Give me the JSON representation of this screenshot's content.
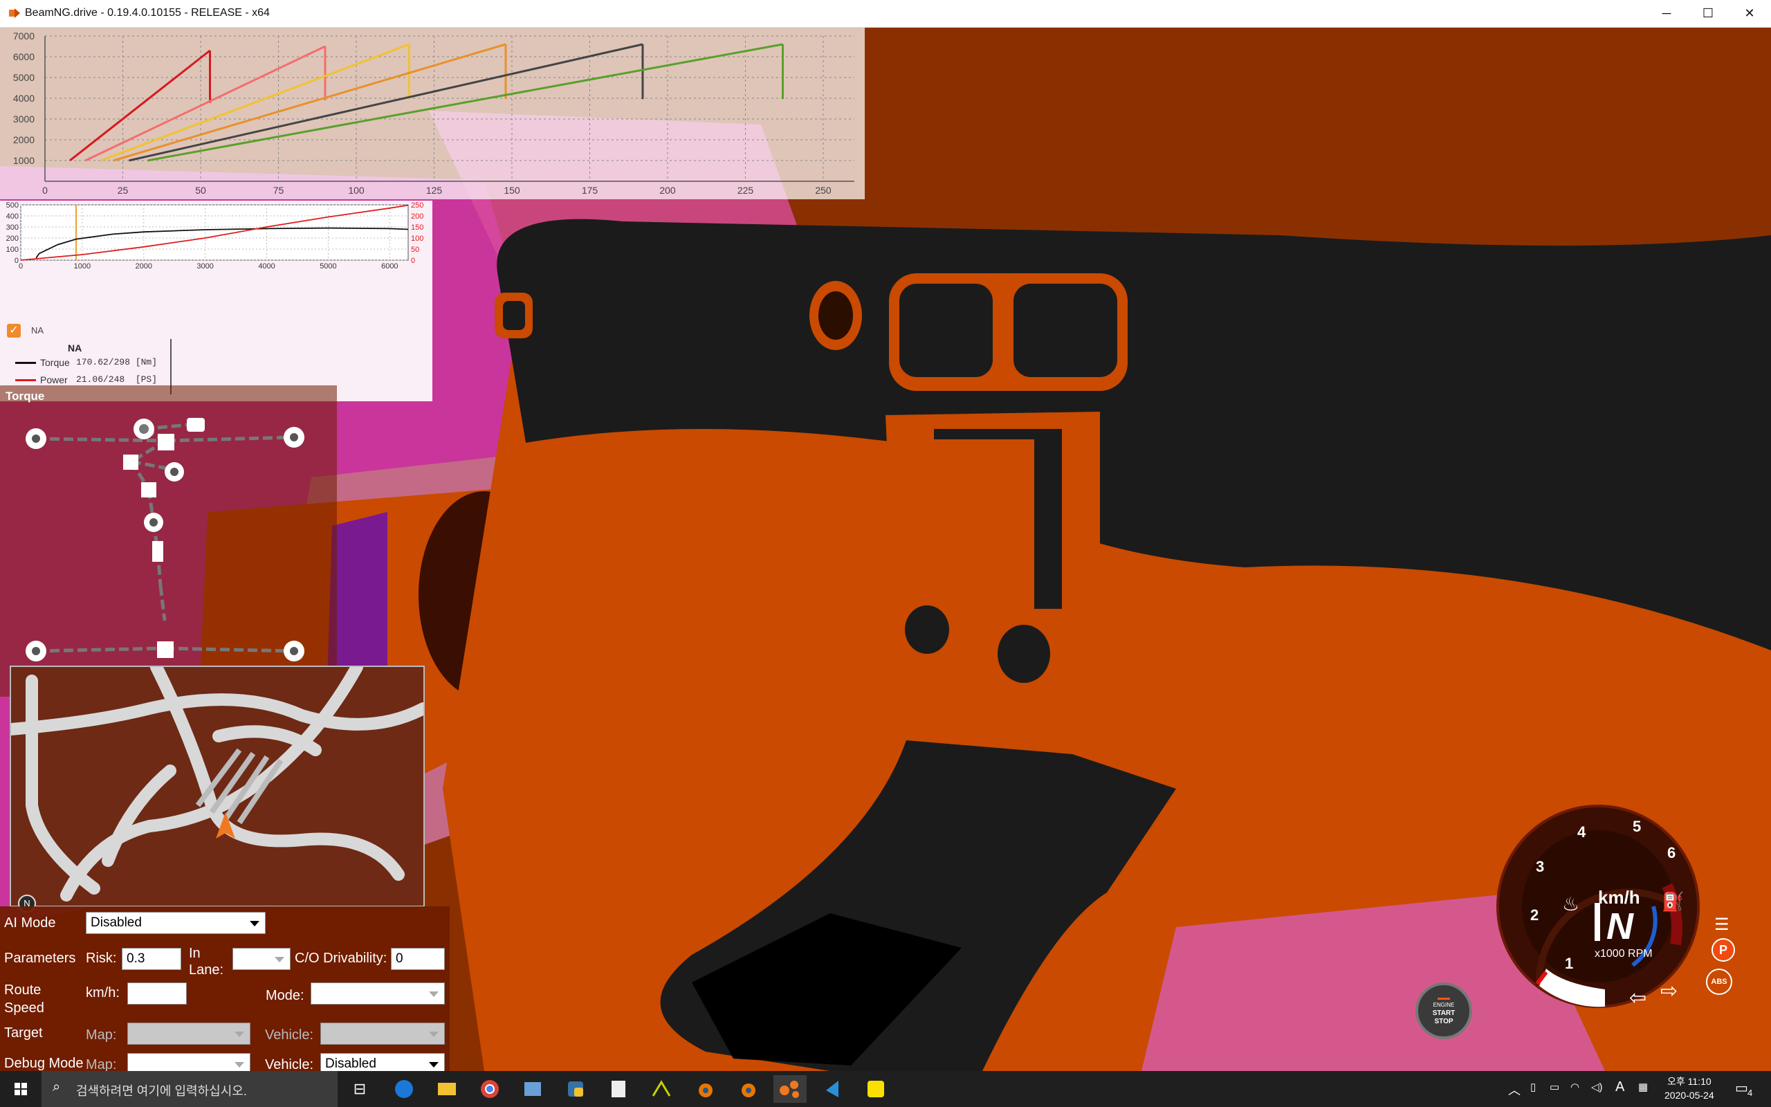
{
  "window": {
    "title": "BeamNG.drive - 0.19.4.0.10155 - RELEASE - x64",
    "minimize_glyph": "─",
    "maximize_glyph": "☐",
    "close_glyph": "✕"
  },
  "charts": {
    "top_chart": {
      "y_ticks": [
        "7000",
        "6000",
        "5000",
        "4000",
        "3000",
        "2000",
        "1000"
      ],
      "x_ticks": [
        "0",
        "25",
        "50",
        "75",
        "100",
        "125",
        "150",
        "175",
        "200",
        "225",
        "250"
      ]
    },
    "small_chart": {
      "y_left_ticks": [
        "500",
        "400",
        "300",
        "200",
        "100",
        "0"
      ],
      "y_right_ticks": [
        "250",
        "200",
        "150",
        "100",
        "50",
        "0"
      ],
      "x_ticks": [
        "0",
        "1000",
        "2000",
        "3000",
        "4000",
        "5000",
        "6000"
      ]
    },
    "legend": {
      "checkbox_label": "NA",
      "group_title": "NA",
      "torque_label": "Torque",
      "torque_value": "170.62/298 [Nm]",
      "power_label": "Power",
      "power_value": "21.06/248  [PS]"
    }
  },
  "chart_data": [
    {
      "type": "line",
      "title": "",
      "xlabel": "",
      "ylabel": "",
      "xlim": [
        0,
        260
      ],
      "ylim": [
        0,
        7000
      ],
      "x_ticks": [
        0,
        25,
        50,
        75,
        100,
        125,
        150,
        175,
        200,
        225,
        250
      ],
      "y_ticks": [
        1000,
        2000,
        3000,
        4000,
        5000,
        6000,
        7000
      ],
      "grid": true,
      "series": [
        {
          "color": "#d7191c",
          "points": [
            [
              8,
              1000
            ],
            [
              53,
              6300
            ]
          ]
        },
        {
          "color": "#f46d6d",
          "points": [
            [
              13,
              1000
            ],
            [
              90,
              6500
            ]
          ]
        },
        {
          "color": "#f2c230",
          "points": [
            [
              18,
              1000
            ],
            [
              117,
              6600
            ]
          ]
        },
        {
          "color": "#e8912b",
          "points": [
            [
              22,
              1000
            ],
            [
              148,
              6600
            ]
          ]
        },
        {
          "color": "#444444",
          "points": [
            [
              27,
              1000
            ],
            [
              192,
              6600
            ]
          ]
        },
        {
          "color": "#5aa02c",
          "points": [
            [
              33,
              1000
            ],
            [
              237,
              6600
            ]
          ]
        }
      ]
    },
    {
      "type": "line",
      "title": "",
      "xlabel": "",
      "ylabel": "",
      "xlim": [
        0,
        6300
      ],
      "ylim": [
        0,
        500
      ],
      "y2lim": [
        0,
        250
      ],
      "x_ticks": [
        0,
        1000,
        2000,
        3000,
        4000,
        5000,
        6000
      ],
      "grid": true,
      "legend": "left",
      "series": [
        {
          "name": "Torque",
          "color": "#111111",
          "axis": "left",
          "x": [
            250,
            300,
            600,
            900,
            1500,
            2000,
            3000,
            4000,
            5000,
            6000,
            6300
          ],
          "y": [
            20,
            60,
            140,
            190,
            235,
            255,
            275,
            285,
            290,
            285,
            278
          ]
        },
        {
          "name": "Power",
          "color": "#e01b1b",
          "axis": "right",
          "x": [
            0,
            1000,
            2000,
            3000,
            4000,
            5000,
            6000,
            6300
          ],
          "y": [
            0,
            25,
            60,
            100,
            150,
            195,
            235,
            248
          ]
        }
      ]
    }
  ],
  "powertrain": {
    "title": "Torque"
  },
  "ai_panel": {
    "ai_mode_label": "AI Mode",
    "ai_mode_value": "Disabled",
    "parameters_label": "Parameters",
    "risk_label": "Risk:",
    "risk_value": "0.3",
    "in_lane_label": "In Lane:",
    "drivability_label": "C/O Drivability:",
    "drivability_value": "0",
    "route_speed_label": "Route Speed",
    "kmh_label": "km/h:",
    "mode_label": "Mode:",
    "target_label": "Target",
    "map_label": "Map:",
    "vehicle_label": "Vehicle:",
    "debug_mode_label": "Debug Mode",
    "debug_map_label": "Map:",
    "debug_vehicle_label": "Vehicle:",
    "debug_vehicle_value": "Disabled"
  },
  "minimap": {
    "north_label": "N"
  },
  "gauge": {
    "rpm_numbers": [
      "1",
      "2",
      "3",
      "4",
      "5",
      "6"
    ],
    "speed_unit": "km/h",
    "gear": "N",
    "rpm_unit": "x1000 RPM",
    "park_label": "P",
    "abs_label": "ABS"
  },
  "engine_button": {
    "line1": "ENGINE",
    "line2": "START",
    "line3": "STOP"
  },
  "taskbar": {
    "search_placeholder": "검색하려면 여기에 입력하십시오.",
    "time": "오후 11:10",
    "date": "2020-05-24",
    "lang_indicator": "A",
    "notification_count": "4"
  },
  "colors": {
    "scene_orange": "#c94a00",
    "dash_black": "#1b1b1b",
    "pink": "#e040a8",
    "dark_panel": "#6e1c00"
  }
}
